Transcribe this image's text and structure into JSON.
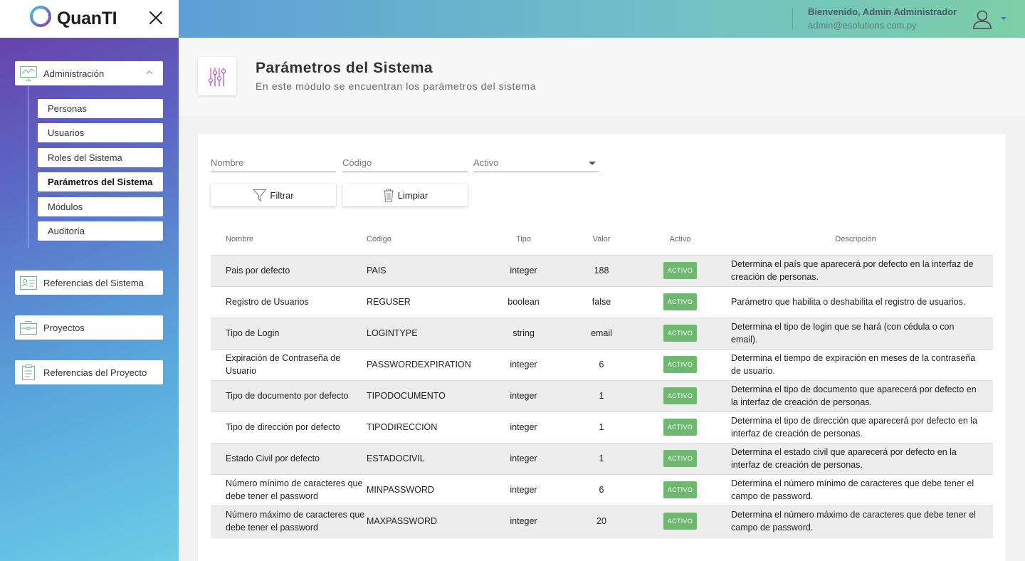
{
  "brand": {
    "logo_text": "QuanTI"
  },
  "header": {
    "welcome": "Bienvenido, Admin Administrador",
    "email": "admin@esolutions.com.py"
  },
  "sidebar": {
    "groups": [
      {
        "label": "Administración",
        "icon": "presentation-chart-icon",
        "expanded": true
      },
      {
        "label": "Referencias del Sistema",
        "icon": "id-card-icon"
      },
      {
        "label": "Proyectos",
        "icon": "briefcase-icon"
      },
      {
        "label": "Referencias del Proyecto",
        "icon": "clipboard-icon"
      }
    ],
    "sub_items": [
      {
        "label": "Personas"
      },
      {
        "label": "Usuarios"
      },
      {
        "label": "Roles del Sistema"
      },
      {
        "label": "Parámetros del Sistema",
        "active": true
      },
      {
        "label": "Módulos"
      },
      {
        "label": "Auditoría"
      }
    ]
  },
  "page": {
    "title": "Parámetros del Sistema",
    "subtitle": "En este módulo se encuentran los parámetros del sistema",
    "icon": "sliders-icon"
  },
  "filters": {
    "nombre_placeholder": "Nombre",
    "codigo_placeholder": "Código",
    "activo_label": "Activo",
    "filter_button": "Filtrar",
    "clear_button": "Limpiar"
  },
  "table": {
    "headers": [
      "Nombre",
      "Código",
      "Tipo",
      "Valor",
      "Activo",
      "Descripción"
    ],
    "rows": [
      {
        "nombre": "Pais por defecto",
        "codigo": "PAIS",
        "tipo": "integer",
        "valor": "188",
        "activo": "ACTIVO",
        "descripcion": "Determina el país que aparecerá por defecto en la interfaz de creación de personas."
      },
      {
        "nombre": "Registro de Usuarios",
        "codigo": "REGUSER",
        "tipo": "boolean",
        "valor": "false",
        "activo": "ACTIVO",
        "descripcion": "Parámetro que habilita o deshabilita el registro de usuarios."
      },
      {
        "nombre": "Tipo de Login",
        "codigo": "LOGINTYPE",
        "tipo": "string",
        "valor": "email",
        "activo": "ACTIVO",
        "descripcion": "Determina el tipo de login que se hará (con cédula o con email)."
      },
      {
        "nombre": "Expiración de Contraseña de Usuario",
        "codigo": "PASSWORDEXPIRATION",
        "tipo": "integer",
        "valor": "6",
        "activo": "ACTIVO",
        "descripcion": "Determina el tiempo de expiración en meses de la contraseña de usuario."
      },
      {
        "nombre": "Tipo de documento por defecto",
        "codigo": "TIPODOCUMENTO",
        "tipo": "integer",
        "valor": "1",
        "activo": "ACTIVO",
        "descripcion": "Determina el tipo de documento que aparecerá por defecto en la interfaz de creación de personas."
      },
      {
        "nombre": "Tipo de dirección por defecto",
        "codigo": "TIPODIRECCION",
        "tipo": "integer",
        "valor": "1",
        "activo": "ACTIVO",
        "descripcion": "Determina el tipo de dirección que aparecerá por defecto en la interfaz de creación de personas."
      },
      {
        "nombre": "Estado Civil por defecto",
        "codigo": "ESTADOCIVIL",
        "tipo": "integer",
        "valor": "1",
        "activo": "ACTIVO",
        "descripcion": "Determina el estado civil que aparecerá por defecto en la interfaz de creación de personas."
      },
      {
        "nombre": "Número mínimo de caracteres que debe tener el password",
        "codigo": "MINPASSWORD",
        "tipo": "integer",
        "valor": "6",
        "activo": "ACTIVO",
        "descripcion": "Determina el número mínimo de caracteres que debe tener el campo de password."
      },
      {
        "nombre": "Número máximo de caracteres que debe tener el password",
        "codigo": "MAXPASSWORD",
        "tipo": "integer",
        "valor": "20",
        "activo": "ACTIVO",
        "descripcion": "Determina el número máximo de caracteres que debe tener el campo de password."
      }
    ]
  },
  "colors": {
    "badge_active": "#6fb86f",
    "header_gradient_start": "#5d9fd6",
    "header_gradient_end": "#7ccfa6",
    "sidebar_gradient_top": "#6a3aa6",
    "sidebar_gradient_bottom": "#6ccde6"
  }
}
